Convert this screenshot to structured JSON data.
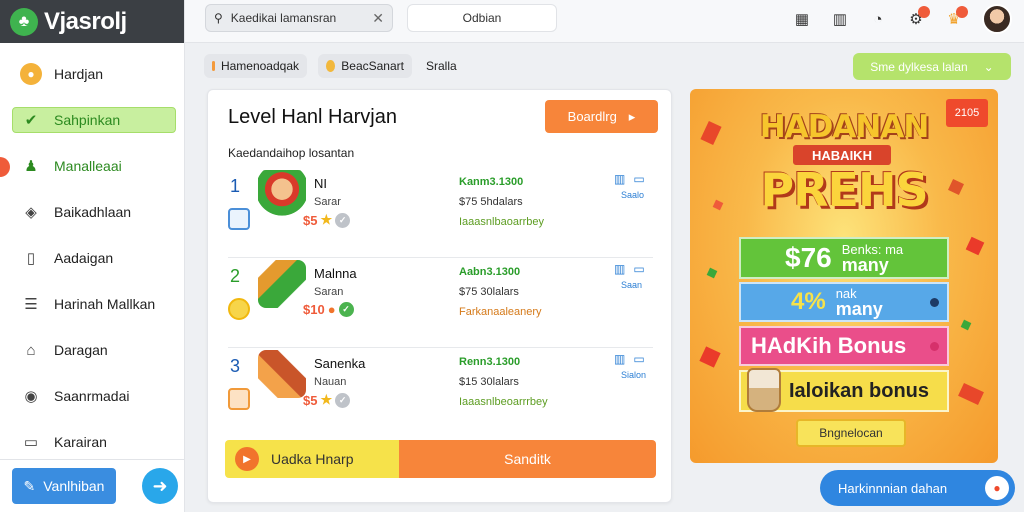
{
  "app": {
    "logo_text": "Vjasrolj"
  },
  "sidebar": {
    "items": [
      {
        "label": "Hardjan",
        "icon": "bag-icon"
      },
      {
        "label": "Sahpinkan",
        "icon": "check-icon",
        "active": true
      },
      {
        "label": "Manalleaai",
        "icon": "users-icon",
        "accent": true
      },
      {
        "label": "Baikadhlaan",
        "icon": "tag-icon"
      },
      {
        "label": "Aadaigan",
        "icon": "clipboard-icon"
      },
      {
        "label": "Harinah Mallkan",
        "icon": "list-icon"
      },
      {
        "label": "Daragan",
        "icon": "home-icon"
      },
      {
        "label": "Saanrmadai",
        "icon": "shield-icon"
      },
      {
        "label": "Karairan",
        "icon": "card-icon"
      }
    ],
    "bottom_button": "Vanlhiban"
  },
  "topbar": {
    "search_value": "Kaedikai lamansran",
    "search2_value": "Odbian"
  },
  "filters": {
    "chip1": "Hamenoadqak",
    "chip2": "BeacSanart",
    "chip3": "Sralla",
    "see_all": "Sme dylkesa lalan"
  },
  "card": {
    "title": "Level Hanl Harvjan",
    "button": "Boardlrg",
    "subtitle": "Kaedandaihop losantan",
    "rows": [
      {
        "rank": "1",
        "name": "NI",
        "sub": "Sarar",
        "stars_value": "$5",
        "amount": "Kanm3.1300",
        "price": "$75 5hdalars",
        "rating": "Iaaasnlbaoarrbey",
        "stat_label": "Saalo"
      },
      {
        "rank": "2",
        "name": "Malnna",
        "sub": "Saran",
        "stars_value": "$10",
        "amount": "Aabn3.1300",
        "price": "$75 30lalars",
        "rating": "Farkanaaleanery",
        "stat_label": "Saan"
      },
      {
        "rank": "3",
        "name": "Sanenka",
        "sub": "Nauan",
        "stars_value": "$5",
        "amount": "Renn3.1300",
        "price": "$15 30lalars",
        "rating": "Iaaasnlbeoarrrbey",
        "stat_label": "Sialon"
      }
    ],
    "footer_left": "Uadka Hnarp",
    "footer_right": "Sanditk"
  },
  "promo": {
    "tag": "2105",
    "hero1": "HADANAN",
    "hero2": "HABAIKH",
    "hero3": "PREHS",
    "offers": [
      {
        "big": "$76",
        "small_a": "Benks: ma",
        "small_b": "many"
      },
      {
        "big": "4%",
        "small_a": "nak",
        "small_b": "many"
      },
      {
        "text": "HAdKih Bonus"
      },
      {
        "text": "Ialoikan bonus"
      }
    ],
    "button": "Bngnelocan"
  },
  "bottom_pill": "Harkinnnian dahan",
  "colors": {
    "accent_green": "#b5e36c",
    "accent_orange": "#f7853a",
    "accent_blue": "#2f86e0"
  }
}
